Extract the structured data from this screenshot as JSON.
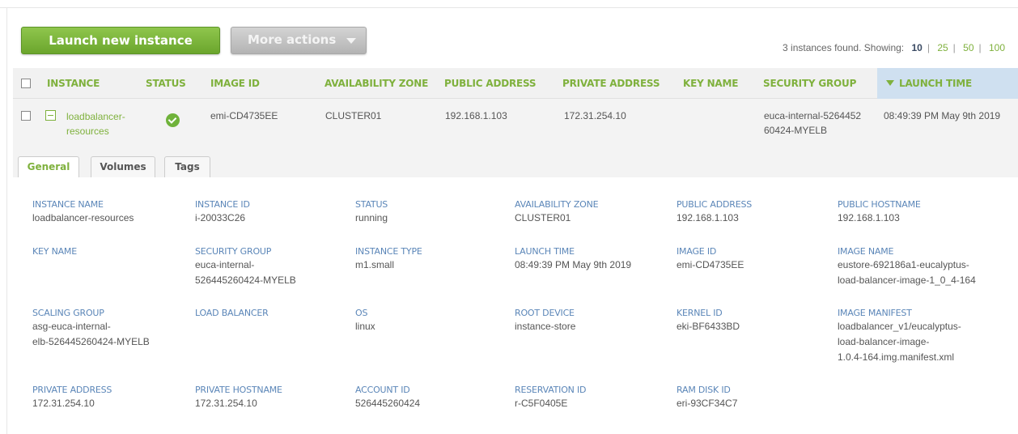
{
  "toolbar": {
    "launch_label": "Launch new instance",
    "more_label": "More actions",
    "found_text": "3 instances found. Showing:",
    "page_sizes": [
      "10",
      "25",
      "50",
      "100"
    ],
    "active_page_size": "10"
  },
  "table": {
    "headers": {
      "instance": "INSTANCE",
      "status": "STATUS",
      "image_id": "IMAGE ID",
      "availability_zone": "AVAILABILITY ZONE",
      "public_address": "PUBLIC ADDRESS",
      "private_address": "PRIVATE ADDRESS",
      "key_name": "KEY NAME",
      "security_group": "SECURITY GROUP",
      "launch_time": "LAUNCH TIME"
    },
    "row": {
      "instance": "loadbalancer-\nresources",
      "status_icon": "check-circle-icon",
      "image_id": "emi-CD4735EE",
      "availability_zone": "CLUSTER01",
      "public_address": "192.168.1.103",
      "private_address": "172.31.254.10",
      "key_name": "",
      "security_group": "euca-internal-5264452\n60424-MYELB",
      "launch_time": "08:49:39 PM May 9th 2019"
    }
  },
  "tabs": [
    "General",
    "Volumes",
    "Tags"
  ],
  "active_tab": "General",
  "details": {
    "instance_name": {
      "label": "INSTANCE NAME",
      "value": "loadbalancer-resources"
    },
    "instance_id": {
      "label": "INSTANCE ID",
      "value": "i-20033C26"
    },
    "status": {
      "label": "STATUS",
      "value": "running"
    },
    "availability_zone": {
      "label": "AVAILABILITY ZONE",
      "value": "CLUSTER01"
    },
    "public_address": {
      "label": "PUBLIC ADDRESS",
      "value": "192.168.1.103"
    },
    "public_hostname": {
      "label": "PUBLIC HOSTNAME",
      "value": "192.168.1.103"
    },
    "key_name": {
      "label": "KEY NAME",
      "value": ""
    },
    "security_group": {
      "label": "SECURITY GROUP",
      "value": "euca-internal-\n526445260424-MYELB"
    },
    "instance_type": {
      "label": "INSTANCE TYPE",
      "value": "m1.small"
    },
    "launch_time": {
      "label": "LAUNCH TIME",
      "value": "08:49:39 PM May 9th 2019"
    },
    "image_id": {
      "label": "IMAGE ID",
      "value": "emi-CD4735EE"
    },
    "image_name": {
      "label": "IMAGE NAME",
      "value": "eustore-692186a1-eucalyptus-\nload-balancer-image-1_0_4-164"
    },
    "scaling_group": {
      "label": "SCALING GROUP",
      "value": "asg-euca-internal-\nelb-526445260424-MYELB"
    },
    "load_balancer": {
      "label": "LOAD BALANCER",
      "value": ""
    },
    "os": {
      "label": "OS",
      "value": "linux"
    },
    "root_device": {
      "label": "ROOT DEVICE",
      "value": "instance-store"
    },
    "kernel_id": {
      "label": "KERNEL ID",
      "value": "eki-BF6433BD"
    },
    "image_manifest": {
      "label": "IMAGE MANIFEST",
      "value": "loadbalancer_v1/eucalyptus-\nload-balancer-image-\n1.0.4-164.img.manifest.xml"
    },
    "private_address": {
      "label": "PRIVATE ADDRESS",
      "value": "172.31.254.10"
    },
    "private_hostname": {
      "label": "PRIVATE HOSTNAME",
      "value": "172.31.254.10"
    },
    "account_id": {
      "label": "ACCOUNT ID",
      "value": "526445260424"
    },
    "reservation_id": {
      "label": "RESERVATION ID",
      "value": "r-C5F0405E"
    },
    "ram_disk_id": {
      "label": "RAM DISK ID",
      "value": "eri-93CF34C7"
    }
  },
  "colors": {
    "accent_green": "#7fb13d",
    "label_blue": "#5b86b8",
    "sorted_column_bg": "#cfe0f0"
  }
}
